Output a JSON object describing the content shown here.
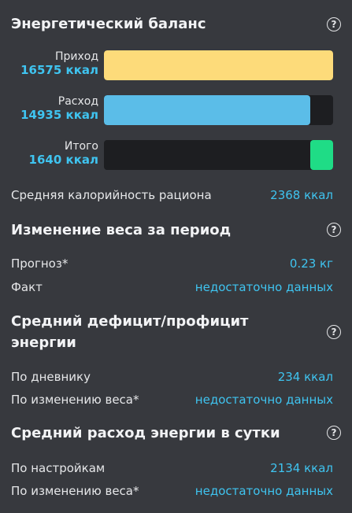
{
  "energy_balance": {
    "title": "Энергетический баланс",
    "bars": [
      {
        "label": "Приход",
        "value": "16575 ккал",
        "fraction": 1.0,
        "color": "#fddb7a"
      },
      {
        "label": "Расход",
        "value": "14935 ккал",
        "fraction": 0.901,
        "color": "#5bbde8"
      },
      {
        "label": "Итого",
        "value": "1640 ккал",
        "fraction": 0.099,
        "color": "#1fdc86",
        "align": "right"
      }
    ],
    "avg_label": "Средняя калорийность рациона",
    "avg_value": "2368 ккал"
  },
  "weight_change": {
    "title": "Изменение веса за период",
    "rows": [
      {
        "label": "Прогноз*",
        "value": "0.23 кг"
      },
      {
        "label": "Факт",
        "value": "недостаточно данных"
      }
    ]
  },
  "deficit": {
    "title_line1": "Средний дефицит/профицит",
    "title_line2": "энергии",
    "rows": [
      {
        "label": "По дневнику",
        "value": "234 ккал"
      },
      {
        "label": "По изменению веса*",
        "value": "недостаточно данных"
      }
    ]
  },
  "expenditure": {
    "title": "Средний расход энергии в сутки",
    "rows": [
      {
        "label": "По настройкам",
        "value": "2134 ккал"
      },
      {
        "label": "По изменению веса*",
        "value": "недостаточно данных"
      }
    ]
  },
  "help_glyph": "?",
  "colors": {
    "background": "#37393e",
    "accent_value": "#3fc4f0",
    "track": "#1d1e21"
  },
  "icons": {
    "help": "question-circle-icon"
  }
}
